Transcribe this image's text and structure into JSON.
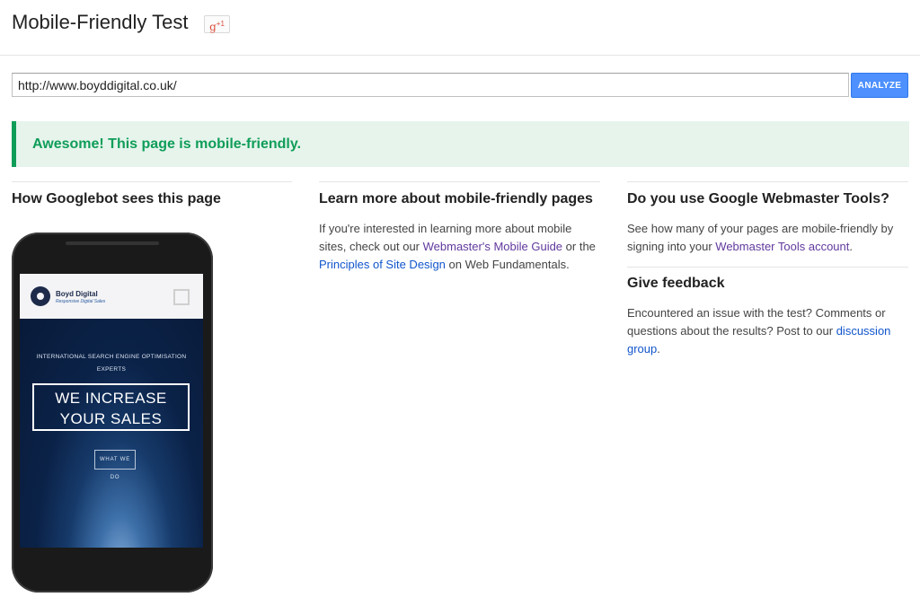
{
  "header": {
    "title": "Mobile-Friendly Test",
    "gplus_label": "g",
    "gplus_sup": "+1"
  },
  "search": {
    "url_value": "http://www.boyddigital.co.uk/",
    "analyze_label": "ANALYZE"
  },
  "result": {
    "message": "Awesome! This page is mobile-friendly.",
    "color": "#0f9d58"
  },
  "col1": {
    "heading": "How Googlebot sees this page"
  },
  "phone_screen": {
    "brand": "Boyd Digital",
    "brand_sub": "Responsive Digital Sales",
    "tagline_line1": "INTERNATIONAL SEARCH ENGINE OPTIMISATION",
    "tagline_line2": "EXPERTS",
    "headline_line1": "WE INCREASE",
    "headline_line2": "YOUR SALES",
    "cta": "WHAT WE DO"
  },
  "col2": {
    "heading": "Learn more about mobile-friendly pages",
    "text_part1": "If you're interested in learning more about mobile sites, check out our ",
    "link1": "Webmaster's Mobile Guide",
    "text_part2": " or the ",
    "link2": "Principles of Site Design",
    "text_part3": " on Web Fundamentals."
  },
  "col3": {
    "heading": "Do you use Google Webmaster Tools?",
    "text_part1": "See how many of your pages are mobile-friendly by signing into your ",
    "link1": "Webmaster Tools account",
    "text_part2": "."
  },
  "feedback": {
    "heading": "Give feedback",
    "text_part1": "Encountered an issue with the test? Comments or questions about the results? Post to our ",
    "link1": "discussion group",
    "text_part2": "."
  }
}
